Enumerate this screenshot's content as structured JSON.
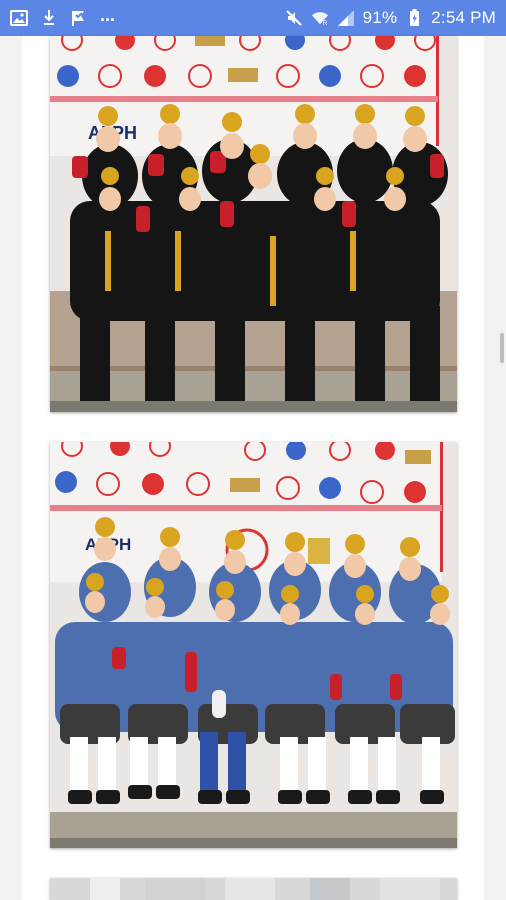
{
  "status_bar": {
    "background": "#5b86e5",
    "left_icons": [
      "gallery-icon",
      "download-icon",
      "check-flag-icon"
    ],
    "overflow": "...",
    "battery_percent": "91%",
    "time": "2:54 PM"
  },
  "backdrop": {
    "banner_label_1": "ALPH",
    "banner_label_2": "ALPH"
  },
  "photos": [
    {
      "name": "group-photo-black-uniform",
      "uniform_color": "#151515",
      "accent_color": "#c8202a"
    },
    {
      "name": "group-photo-blue-uniform",
      "uniform_color": "#4d6fb0",
      "accent_color": "#c8202a"
    },
    {
      "name": "group-photo-partial"
    }
  ]
}
